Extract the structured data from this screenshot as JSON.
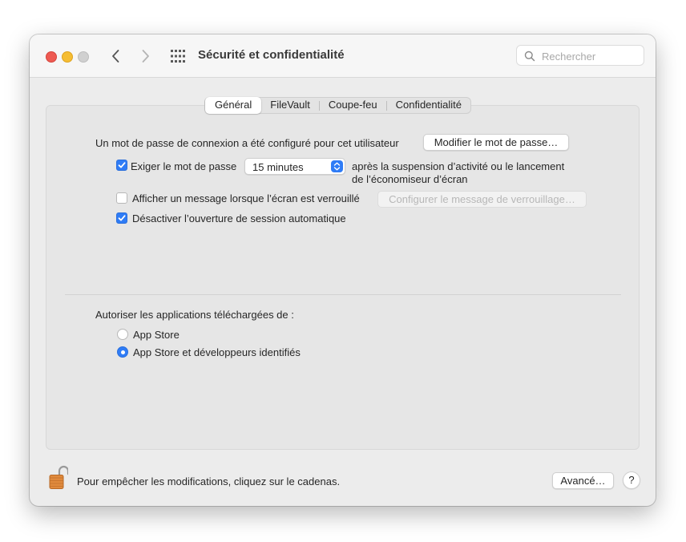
{
  "window": {
    "title": "Sécurité et confidentialité",
    "search_placeholder": "Rechercher"
  },
  "tabs": [
    {
      "label": "Général",
      "active": true
    },
    {
      "label": "FileVault",
      "active": false
    },
    {
      "label": "Coupe-feu",
      "active": false
    },
    {
      "label": "Confidentialité",
      "active": false
    }
  ],
  "general": {
    "password_text": "Un mot de passe de connexion a été configuré pour cet utilisateur",
    "change_password_button": "Modifier le mot de passe…",
    "require_password": {
      "label": "Exiger le mot de passe",
      "checked": true,
      "delay_value": "15 minutes",
      "suffix_line1": "après la suspension d’activité ou le lancement",
      "suffix_line2": "de l’économiseur d’écran"
    },
    "show_message": {
      "label": "Afficher un message lorsque l’écran est verrouillé",
      "checked": false,
      "button": "Configurer le message de verrouillage…"
    },
    "disable_autologin": {
      "label": "Désactiver l’ouverture de session automatique",
      "checked": true
    }
  },
  "downloads": {
    "heading": "Autoriser les applications téléchargées de :",
    "options": [
      {
        "label": "App Store",
        "selected": false
      },
      {
        "label": "App Store et développeurs identifiés",
        "selected": true
      }
    ]
  },
  "footer": {
    "lock_text": "Pour empêcher les modifications, cliquez sur le cadenas.",
    "advanced_button": "Avancé…",
    "help_label": "?"
  },
  "colors": {
    "accent": "#2f7cf6",
    "traffic_close": "#ee5a52",
    "traffic_minimize": "#f5bd33",
    "traffic_zoom": "#d0d0d0",
    "lock": "#e08a3c"
  }
}
